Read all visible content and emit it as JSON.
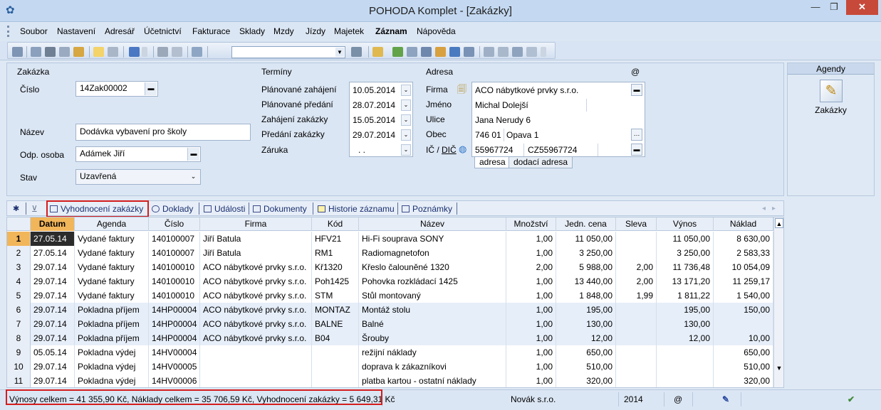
{
  "window": {
    "title": "POHODA Komplet - [Zakázky]"
  },
  "menu": [
    "Soubor",
    "Nastavení",
    "Adresář",
    "Účetnictví",
    "Fakturace",
    "Sklady",
    "Mzdy",
    "Jízdy",
    "Majetek",
    "Záznam",
    "Nápověda"
  ],
  "form": {
    "zakazka_header": "Zakázka",
    "cislo_label": "Číslo",
    "cislo_value": "14Zak00002",
    "nazev_label": "Název",
    "nazev_value": "Dodávka vybavení pro školy",
    "odp_label": "Odp. osoba",
    "odp_value": "Adámek Jiří",
    "stav_label": "Stav",
    "stav_value": "Uzavřená",
    "terminy_header": "Termíny",
    "terminy": [
      {
        "label": "Plánované zahájení",
        "value": "10.05.2014"
      },
      {
        "label": "Plánované předání",
        "value": "28.07.2014"
      },
      {
        "label": "Zahájení zakázky",
        "value": "15.05.2014"
      },
      {
        "label": "Předání zakázky",
        "value": "29.07.2014"
      },
      {
        "label": "Záruka",
        "value": ". ."
      }
    ],
    "adresa_header": "Adresa",
    "at_sign": "@",
    "firma_label": "Firma",
    "firma_value": "ACO nábytkové prvky s.r.o.",
    "jmeno_label": "Jméno",
    "jmeno_value": "Michal Dolejší",
    "ulice_label": "Ulice",
    "ulice_value": "Jana Nerudy 6",
    "obec_label": "Obec",
    "psc_value": "746 01",
    "obec_value": "Opava 1",
    "ic_label": "IČ / ",
    "dic_label": "DIČ",
    "ic_value": "55967724",
    "dic_value": "CZ55967724",
    "tab_adresa": "adresa",
    "tab_dodaci": "dodací adresa"
  },
  "agendy": {
    "header": "Agendy",
    "item": "Zakázky"
  },
  "tabs": {
    "star": "✱",
    "items": [
      "Vyhodnocení zakázky",
      "Doklady",
      "Události",
      "Dokumenty",
      "Historie záznamu",
      "Poznámky"
    ]
  },
  "table": {
    "columns": [
      "Datum",
      "Agenda",
      "Číslo",
      "Firma",
      "Kód",
      "Název",
      "Množství",
      "Jedn. cena",
      "Sleva",
      "Výnos",
      "Náklad"
    ],
    "rows": [
      {
        "n": "1",
        "datum": "27.05.14",
        "agenda": "Vydané faktury",
        "cislo": "140100007",
        "firma": "Jiří Batula",
        "kod": "HFV21",
        "nazev": "Hi-Fi souprava SONY",
        "mnozstvi": "1,00",
        "cena": "11 050,00",
        "sleva": "",
        "vynos": "11 050,00",
        "naklad": "8 630,00"
      },
      {
        "n": "2",
        "datum": "27.05.14",
        "agenda": "Vydané faktury",
        "cislo": "140100007",
        "firma": "Jiří Batula",
        "kod": "RM1",
        "nazev": "Radiomagnetofon",
        "mnozstvi": "1,00",
        "cena": "3 250,00",
        "sleva": "",
        "vynos": "3 250,00",
        "naklad": "2 583,33"
      },
      {
        "n": "3",
        "datum": "29.07.14",
        "agenda": "Vydané faktury",
        "cislo": "140100010",
        "firma": "ACO nábytkové prvky s.r.o.",
        "kod": "Kř1320",
        "nazev": "Křeslo čalouněné 1320",
        "mnozstvi": "2,00",
        "cena": "5 988,00",
        "sleva": "2,00",
        "vynos": "11 736,48",
        "naklad": "10 054,09"
      },
      {
        "n": "4",
        "datum": "29.07.14",
        "agenda": "Vydané faktury",
        "cislo": "140100010",
        "firma": "ACO nábytkové prvky s.r.o.",
        "kod": "Poh1425",
        "nazev": "Pohovka rozkládací 1425",
        "mnozstvi": "1,00",
        "cena": "13 440,00",
        "sleva": "2,00",
        "vynos": "13 171,20",
        "naklad": "11 259,17"
      },
      {
        "n": "5",
        "datum": "29.07.14",
        "agenda": "Vydané faktury",
        "cislo": "140100010",
        "firma": "ACO nábytkové prvky s.r.o.",
        "kod": "STM",
        "nazev": "Stůl montovaný",
        "mnozstvi": "1,00",
        "cena": "1 848,00",
        "sleva": "1,99",
        "vynos": "1 811,22",
        "naklad": "1 540,00"
      },
      {
        "n": "6",
        "datum": "29.07.14",
        "agenda": "Pokladna příjem",
        "cislo": "14HP00004",
        "firma": "ACO nábytkové prvky s.r.o.",
        "kod": "MONTAZ",
        "nazev": "Montáž stolu",
        "mnozstvi": "1,00",
        "cena": "195,00",
        "sleva": "",
        "vynos": "195,00",
        "naklad": "150,00"
      },
      {
        "n": "7",
        "datum": "29.07.14",
        "agenda": "Pokladna příjem",
        "cislo": "14HP00004",
        "firma": "ACO nábytkové prvky s.r.o.",
        "kod": "BALNE",
        "nazev": "Balné",
        "mnozstvi": "1,00",
        "cena": "130,00",
        "sleva": "",
        "vynos": "130,00",
        "naklad": ""
      },
      {
        "n": "8",
        "datum": "29.07.14",
        "agenda": "Pokladna příjem",
        "cislo": "14HP00004",
        "firma": "ACO nábytkové prvky s.r.o.",
        "kod": "B04",
        "nazev": "Šrouby",
        "mnozstvi": "1,00",
        "cena": "12,00",
        "sleva": "",
        "vynos": "12,00",
        "naklad": "10,00"
      },
      {
        "n": "9",
        "datum": "05.05.14",
        "agenda": "Pokladna výdej",
        "cislo": "14HV00004",
        "firma": "",
        "kod": "",
        "nazev": "režijní náklady",
        "mnozstvi": "1,00",
        "cena": "650,00",
        "sleva": "",
        "vynos": "",
        "naklad": "650,00"
      },
      {
        "n": "10",
        "datum": "29.07.14",
        "agenda": "Pokladna výdej",
        "cislo": "14HV00005",
        "firma": "",
        "kod": "",
        "nazev": "doprava k zákazníkovi",
        "mnozstvi": "1,00",
        "cena": "510,00",
        "sleva": "",
        "vynos": "",
        "naklad": "510,00"
      },
      {
        "n": "11",
        "datum": "29.07.14",
        "agenda": "Pokladna výdej",
        "cislo": "14HV00006",
        "firma": "",
        "kod": "",
        "nazev": "platba kartou - ostatní náklady",
        "mnozstvi": "1,00",
        "cena": "320,00",
        "sleva": "",
        "vynos": "",
        "naklad": "320,00"
      }
    ]
  },
  "status": {
    "summary": "Výnosy celkem = 41 355,90 Kč, Náklady celkem = 35 706,59 Kč, Vyhodnocení zakázky = 5 649,31 Kč",
    "company": "Novák s.r.o.",
    "year": "2014",
    "at": "@"
  },
  "colors": {
    "highlight_red": "#d41d1d",
    "active_header": "#f1b55a",
    "selected_cell": "#2b2b2b"
  }
}
